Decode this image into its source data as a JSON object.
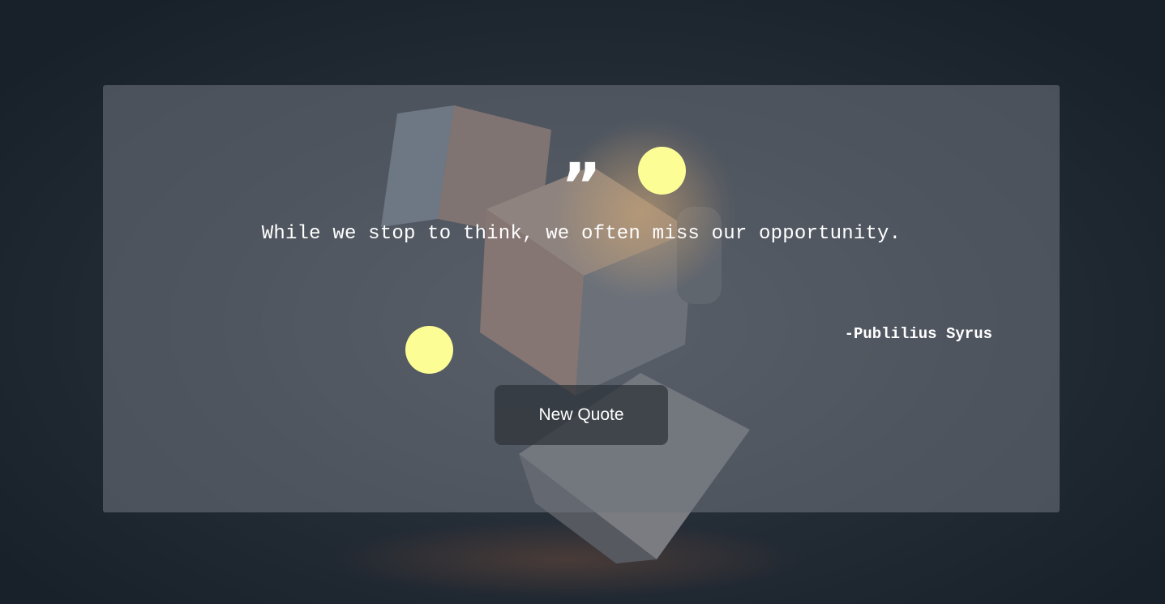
{
  "quote": {
    "mark": "”",
    "text": "While we stop to think, we often miss our opportunity.",
    "author": "-Publilius Syrus"
  },
  "button": {
    "label": "New Quote"
  },
  "colors": {
    "accent_dot": "#fdfd96",
    "text": "#ffffff",
    "button_bg": "#2d3238"
  },
  "icons": {
    "quote": "quote-icon"
  }
}
